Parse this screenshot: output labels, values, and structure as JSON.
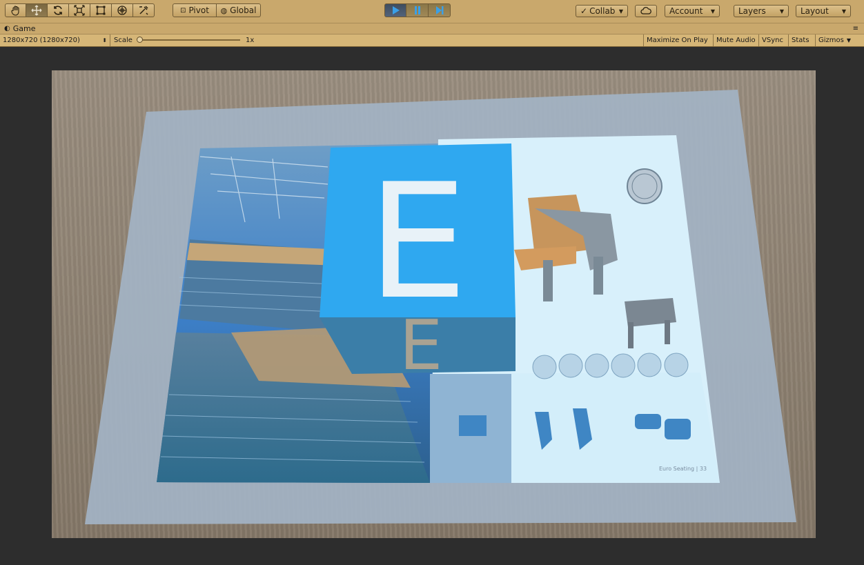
{
  "toolbar": {
    "tools": [
      {
        "name": "hand-tool",
        "icon": "hand-icon"
      },
      {
        "name": "move-tool",
        "icon": "move-arrows-icon"
      },
      {
        "name": "rotate-tool",
        "icon": "rotate-icon"
      },
      {
        "name": "scale-tool",
        "icon": "scale-icon"
      },
      {
        "name": "rect-tool",
        "icon": "rect-transform-icon"
      },
      {
        "name": "transform-tool",
        "icon": "transform-icon"
      },
      {
        "name": "custom-tool",
        "icon": "custom-tools-icon"
      }
    ],
    "pivot_label": "Pivot",
    "global_label": "Global",
    "play_state": "playing",
    "collab_label": "Collab",
    "account_label": "Account",
    "layers_label": "Layers",
    "layout_label": "Layout"
  },
  "game_tab": {
    "title": "Game"
  },
  "game_bar": {
    "resolution": "1280x720 (1280x720)",
    "scale_label": "Scale",
    "scale_value": "1x",
    "maximize_on_play": "Maximize On Play",
    "mute_audio": "Mute Audio",
    "vsync": "VSync",
    "stats": "Stats",
    "gizmos": "Gizmos"
  },
  "scene": {
    "cube_letter": "E",
    "cube_color": "#2fa8f0",
    "brochure_footer": "Euro Seating | 33"
  },
  "colors": {
    "toolbar_bg": "#c9a86c",
    "viewport_bg": "#2d2d2d",
    "cube_front": "#2fa8f0",
    "cube_bottom": "#3b7ea8"
  }
}
